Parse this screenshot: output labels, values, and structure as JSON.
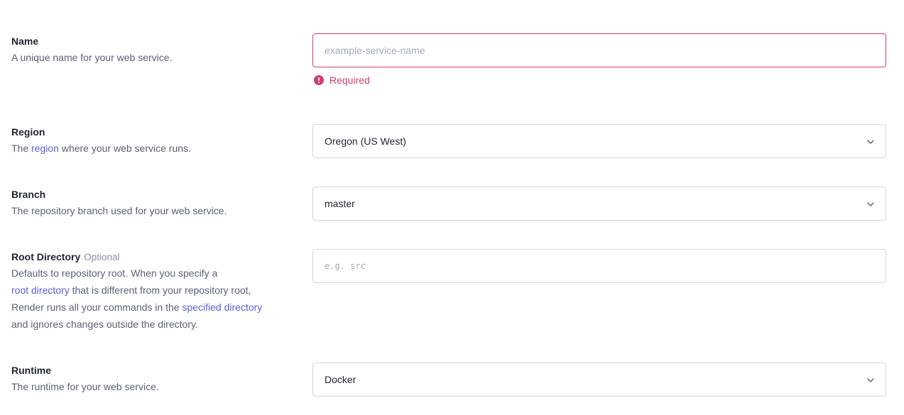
{
  "name": {
    "title": "Name",
    "description": "A unique name for your web service.",
    "placeholder": "example-service-name",
    "value": "",
    "error": "Required",
    "icon": "alert-circle-icon",
    "error_color": "#d23c6e"
  },
  "region": {
    "title": "Region",
    "desc_prefix": "The ",
    "desc_link": "region",
    "desc_suffix": " where your web service runs.",
    "selected": "Oregon (US West)",
    "icon": "chevron-down-icon"
  },
  "branch": {
    "title": "Branch",
    "description": "The repository branch used for your web service.",
    "selected": "master",
    "icon": "chevron-down-icon"
  },
  "root_directory": {
    "title": "Root Directory",
    "optional_label": "Optional",
    "desc_line1": "Defaults to repository root. When you specify a",
    "desc_link1": "root directory",
    "desc_line2_suffix": " that is different from your repository root,",
    "desc_line3_prefix": "Render runs all your commands in the ",
    "desc_link2": "specified directory",
    "desc_line4": "and ignores changes outside the directory.",
    "placeholder": "e.g. src",
    "value": ""
  },
  "runtime": {
    "title": "Runtime",
    "description": "The runtime for your web service.",
    "selected": "Docker",
    "icon": "chevron-down-icon"
  },
  "colors": {
    "link": "#5b5fd6",
    "border": "#d3d8e6",
    "error": "#d23c6e"
  }
}
